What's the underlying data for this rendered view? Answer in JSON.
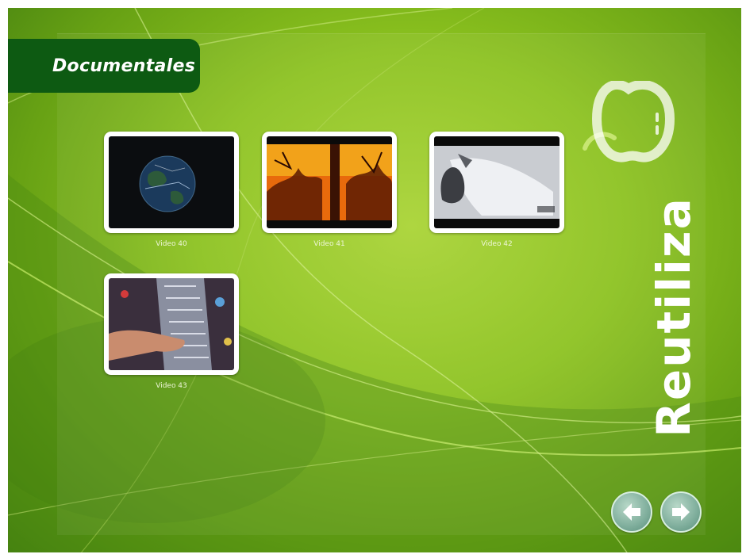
{
  "header": {
    "title": "Documentales"
  },
  "brand": {
    "text": "Reutiliza",
    "icon": "apple-icon"
  },
  "videos": [
    {
      "label": "Video 40",
      "thumbnail": "earth-in-space"
    },
    {
      "label": "Video 41",
      "thumbnail": "forest-fire"
    },
    {
      "label": "Video 42",
      "thumbnail": "plane-crash"
    },
    {
      "label": "Video 43",
      "thumbnail": "hand-on-mosaic"
    }
  ],
  "navigation": {
    "prev_icon": "arrow-left-icon",
    "next_icon": "arrow-right-icon"
  },
  "colors": {
    "background": "#8cc21f",
    "title_tab": "#0d5a12",
    "nav_button": "#7fae9c"
  }
}
